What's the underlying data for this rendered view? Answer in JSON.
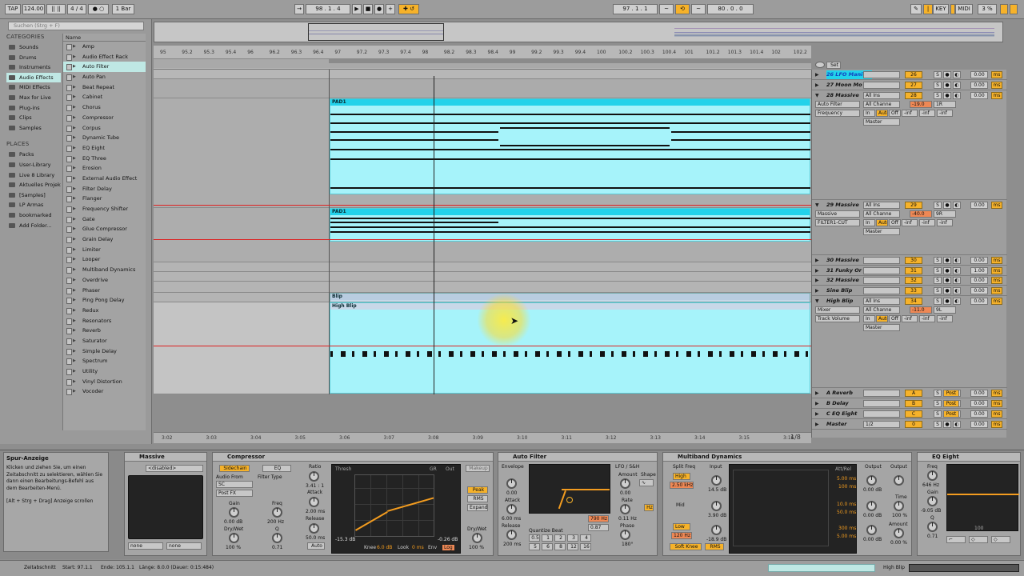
{
  "topbar": {
    "tap": "TAP",
    "tempo": "124.00",
    "sig": "4 / 4",
    "quant": "1 Bar",
    "pos": "98 .   1 .   4",
    "loop_start": "97 .   1 .   1",
    "loop_len": "80 .   0 .   0",
    "key": "KEY",
    "midi": "MIDI",
    "cpu": "3 %"
  },
  "browser": {
    "search_placeholder": "Suchen (Strg + F)",
    "categories_title": "CATEGORIES",
    "categories": [
      "Sounds",
      "Drums",
      "Instruments",
      "Audio Effects",
      "MIDI Effects",
      "Max for Live",
      "Plug-ins",
      "Clips",
      "Samples"
    ],
    "places_title": "PLACES",
    "places": [
      "Packs",
      "User-Library",
      "Live 8 Library",
      "Aktuelles Projekt",
      "[Samples]",
      "LP Armas",
      "bookmarked",
      "Add Folder..."
    ],
    "name_header": "Name",
    "items": [
      "Amp",
      "Audio Effect Rack",
      "Auto Filter",
      "Auto Pan",
      "Beat Repeat",
      "Cabinet",
      "Chorus",
      "Compressor",
      "Corpus",
      "Dynamic Tube",
      "EQ Eight",
      "EQ Three",
      "Erosion",
      "External Audio Effect",
      "Filter Delay",
      "Flanger",
      "Frequency Shifter",
      "Gate",
      "Glue Compressor",
      "Grain Delay",
      "Limiter",
      "Looper",
      "Multiband Dynamics",
      "Overdrive",
      "Phaser",
      "Ping Pong Delay",
      "Redux",
      "Resonators",
      "Reverb",
      "Saturator",
      "Simple Delay",
      "Spectrum",
      "Utility",
      "Vinyl Distortion",
      "Vocoder"
    ]
  },
  "ruler": {
    "labels": [
      "95",
      "95.2",
      "95.3",
      "95.4",
      "96",
      "96.2",
      "96.3",
      "96.4",
      "97",
      "97.2",
      "97.3",
      "97.4",
      "98",
      "98.2",
      "98.3",
      "98.4",
      "99",
      "99.2",
      "99.3",
      "99.4",
      "100",
      "100.2",
      "100.3",
      "100.4",
      "101",
      "101.2",
      "101.3",
      "101.4",
      "102",
      "102.2"
    ]
  },
  "timebar": {
    "labels": [
      "3:02",
      "3:03",
      "3:04",
      "3:05",
      "3:06",
      "3:07",
      "3:08",
      "3:09",
      "3:10",
      "3:11",
      "3:12",
      "3:13",
      "3:14",
      "3:15",
      "3:16"
    ],
    "page": "1/8"
  },
  "clips": {
    "pad1_a": "PAD1",
    "pad1_b": "PAD1",
    "blip": "Blip",
    "high_blip": "High Blip"
  },
  "tracks": [
    {
      "name": "26 LFO Mani",
      "num": "26",
      "vol": "0.00",
      "sel": true
    },
    {
      "name": "27 Moon Mo",
      "num": "27",
      "vol": "0.00"
    },
    {
      "name": "28 Massive",
      "num": "28",
      "vol": "0.00",
      "route": "All Ins",
      "ch": "All Channe",
      "dev1": "Auto Filter",
      "dev2": "Frequency",
      "val": "-19.0",
      "pan": "1R",
      "out": "Master"
    },
    {
      "name": "29 Massive",
      "num": "29",
      "vol": "0.00",
      "route": "All Ins",
      "ch": "All Channe",
      "dev1": "Massive",
      "dev2": "FILTER1-CUT",
      "val": "-40.0",
      "pan": "9R",
      "out": "Master"
    },
    {
      "name": "30 Massive",
      "num": "30",
      "vol": "0.00"
    },
    {
      "name": "31 Funky Or",
      "num": "31",
      "vol": "1.00"
    },
    {
      "name": "32 Massive",
      "num": "32",
      "vol": "0.00"
    },
    {
      "name": "Sine Blip",
      "num": "33",
      "vol": "0.00"
    },
    {
      "name": "High Blip",
      "num": "34",
      "vol": "0.00",
      "route": "All Ins",
      "ch": "All Channe",
      "dev1": "Mixer",
      "dev2": "Track Volume",
      "val": "-11.0",
      "pan": "9L",
      "out": "Master"
    },
    {
      "name": "A Reverb",
      "num": "A",
      "vol": "0.00",
      "post": "Post"
    },
    {
      "name": "B Delay",
      "num": "B",
      "vol": "0.00",
      "post": "Post"
    },
    {
      "name": "C EQ Eight",
      "num": "C",
      "vol": "0.00",
      "post": "Post"
    },
    {
      "name": "Master",
      "num": "0",
      "vol": "0.00",
      "sel2": "1/2"
    }
  ],
  "trackhdr_misc": {
    "set": "Set",
    "in": "In",
    "auto": "Auto",
    "off": "Off",
    "inf": "-inf",
    "ms": "ms",
    "s": "S"
  },
  "info": {
    "title": "Spur-Anzeige",
    "text": "Klicken und ziehen Sie, um einen Zeitabschnitt zu selektieren, wählen Sie dann einen Bearbeitungs-Befehl aus dem Bearbeiten-Menü.",
    "hint": "[Alt + Strg + Drag] Anzeige scrollen"
  },
  "devices": {
    "massive": {
      "title": "Massive",
      "preset": "<disabled>",
      "none1": "none",
      "none2": "none"
    },
    "comp": {
      "title": "Compressor",
      "sidechain": "Sidechain",
      "eq": "EQ",
      "audio_from": "Audio From",
      "filter_type": "Filter Type",
      "sc": "SC",
      "postfx": "Post FX",
      "gain": "Gain",
      "gain_v": "0.00 dB",
      "freq": "Freq",
      "freq_v": "200 Hz",
      "drywet": "Dry/Wet",
      "drywet_v": "100 %",
      "q": "Q",
      "q_v": "0.71",
      "ratio": "Ratio",
      "ratio_v": "3.41 : 1",
      "attack": "Attack",
      "attack_v": "2.00 ms",
      "release": "Release",
      "release_v": "50.0 ms",
      "auto": "Auto",
      "thresh": "Thresh",
      "gr": "GR",
      "out": "Out",
      "thresh_v": "-15.3 dB",
      "out_v": "-0.26 dB",
      "knee": "Knee",
      "knee_v": "6.0 dB",
      "look": "Look",
      "look_v": "0 ms",
      "env": "Env",
      "log": "Log",
      "makeup": "Makeup",
      "peak": "Peak",
      "rms": "RMS",
      "expand": "Expand",
      "dw": "Dry/Wet",
      "dw_v": "100 %"
    },
    "autofilter": {
      "title": "Auto Filter",
      "envelope": "Envelope",
      "env_v": "0.00",
      "attack": "Attack",
      "attack_v": "6.00 ms",
      "release": "Release",
      "release_v": "200 ms",
      "lfo": "LFO / S&H",
      "amount": "Amount",
      "amount_v": "0.00",
      "shape": "Shape",
      "rate": "Rate",
      "rate_v": "0.11 Hz",
      "phase": "Phase",
      "phase_v": "180°",
      "freq_v": "790 Hz",
      "q_v": "0.87",
      "quant": "Quantize Beat",
      "on": "On",
      "steps": [
        "0.5",
        "1",
        "2",
        "3",
        "4",
        "5",
        "6",
        "8",
        "12",
        "16"
      ],
      "hz": "Hz"
    },
    "mbd": {
      "title": "Multiband Dynamics",
      "split": "Split Freq",
      "input": "Input",
      "output": "Output",
      "high": "High",
      "high_v": "2.50 kHz",
      "mid": "Mid",
      "low": "Low",
      "low_v": "120 Hz",
      "in_h": "14.5 dB",
      "in_m": "3.90 dB",
      "in_l": "-18.9 dB",
      "out_h": "0.00 dB",
      "out_m": "0.00 dB",
      "out_l": "0.00 dB",
      "soft": "Soft Knee",
      "rms": "RMS",
      "attrel": "Att/Rel",
      "t1": "5.00 ms",
      "t2": "100 ms",
      "t3": "10.0 ms",
      "t4": "50.0 ms",
      "t5": "300 ms",
      "t6": "5.00 ms",
      "outlbl": "Output",
      "time": "Time",
      "time_v": "100 %",
      "amount": "Amount",
      "amount_v": "0.00 %"
    },
    "eq": {
      "title": "EQ Eight",
      "freq": "Freq",
      "freq_v": "646 Hz",
      "gain": "Gain",
      "gain_v": "-9.05 dB",
      "q": "Q",
      "q_v": "0.71",
      "f100": "100"
    }
  },
  "status": {
    "label": "Zeitabschnitt",
    "start": "Start: 97.1.1",
    "end": "Ende: 105.1.1",
    "length": "Länge: 8.0.0 (Dauer: 0:15:484)",
    "track": "High Blip"
  }
}
